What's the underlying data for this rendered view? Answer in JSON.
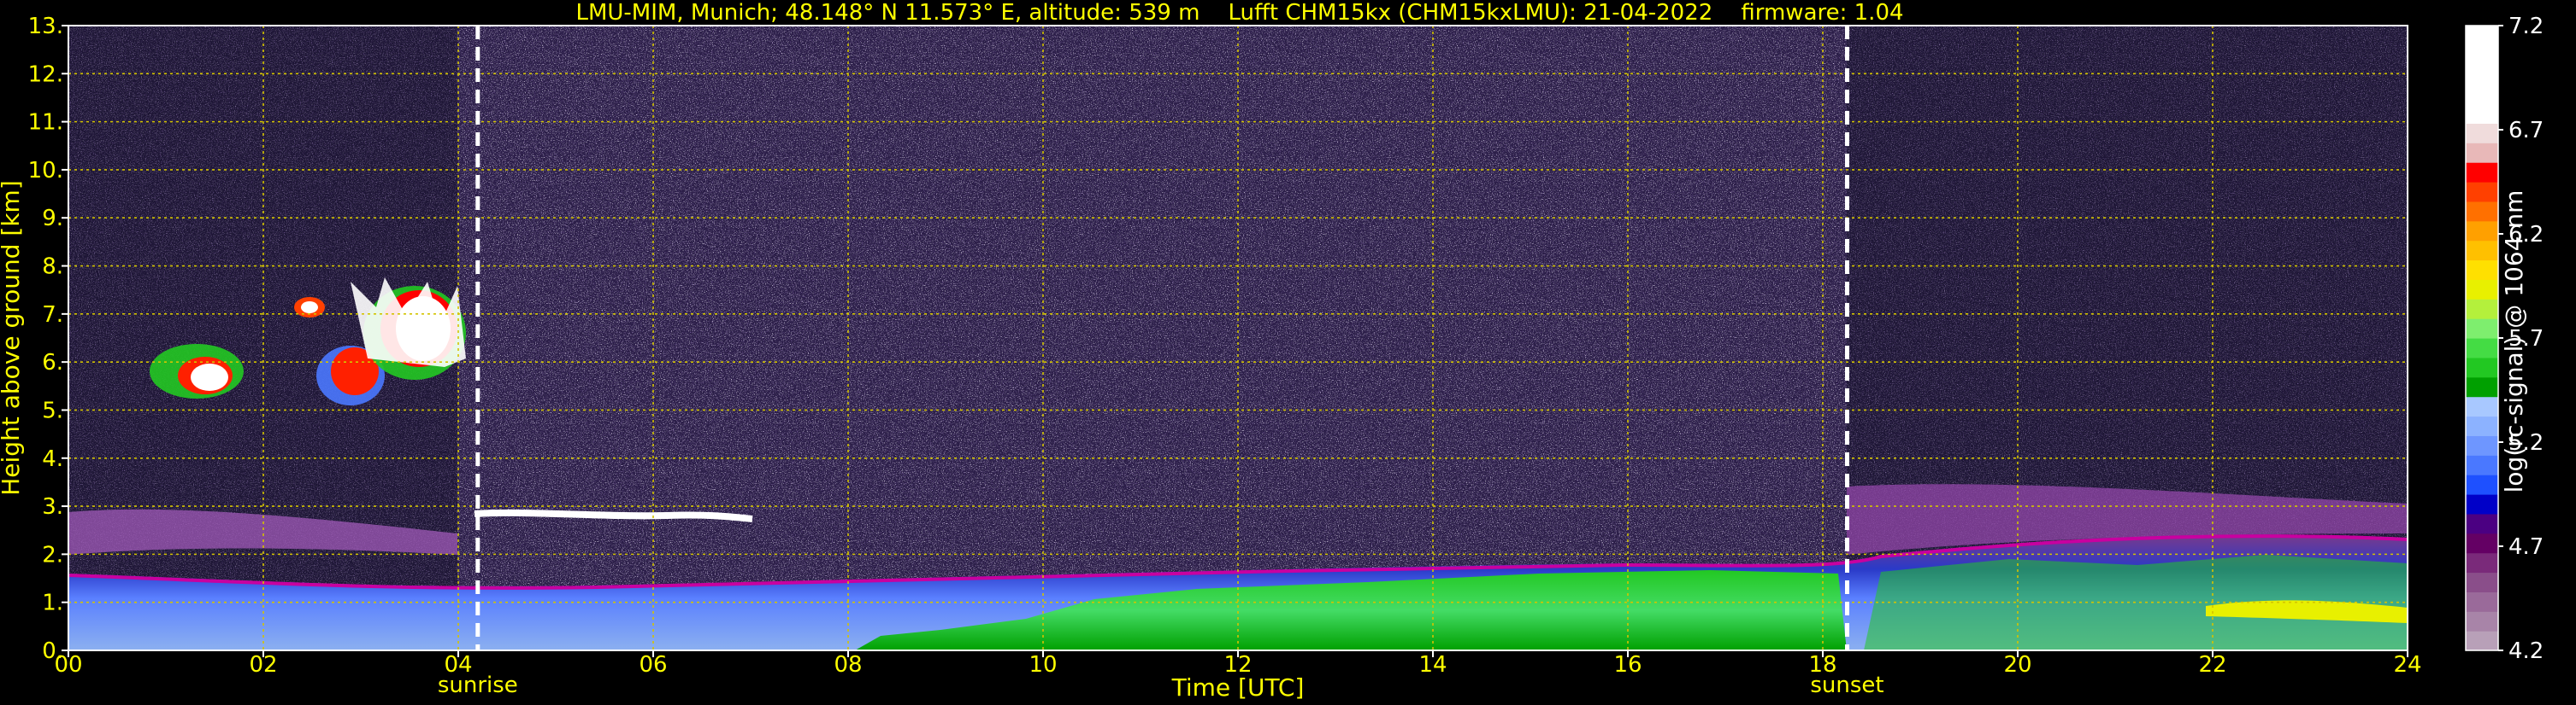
{
  "chart_data": {
    "type": "heatmap",
    "title": "LMU-MIM, Munich; 48.148° N 11.573° E, altitude: 539 m    Lufft CHM15kx (CHM15kxLMU): 21-04-2022    firmware: 1.04",
    "xlabel": "Time [UTC]",
    "ylabel": "Height above ground [km]",
    "xlim": [
      0,
      24
    ],
    "ylim": [
      0,
      13
    ],
    "x_ticks": [
      "00",
      "02",
      "04",
      "06",
      "08",
      "10",
      "12",
      "14",
      "16",
      "18",
      "20",
      "22",
      "24"
    ],
    "y_ticks": [
      "0.",
      "1.",
      "2.",
      "3.",
      "4.",
      "5.",
      "6.",
      "7.",
      "8.",
      "9.",
      "10.",
      "11.",
      "12.",
      "13."
    ],
    "grid": true,
    "colorbar": {
      "label": "log(rc-signal) @ 1064 nm",
      "range": [
        4.2,
        7.2
      ],
      "ticks": [
        "4.2",
        "4.7",
        "5.2",
        "5.7",
        "6.2",
        "6.7",
        "7.2"
      ],
      "colors": [
        "#b8a0b8",
        "#a884a8",
        "#9a6a9a",
        "#8a4e8a",
        "#7a2a7a",
        "#640064",
        "#4b0082",
        "#0000c8",
        "#1e50ff",
        "#4a78ff",
        "#6e96ff",
        "#8cb2ff",
        "#a8c8ff",
        "#00a000",
        "#22c822",
        "#44dc44",
        "#7eee6e",
        "#b4f03c",
        "#e8f000",
        "#ffe000",
        "#ffc000",
        "#ffa000",
        "#ff7000",
        "#ff4000",
        "#ff0000",
        "#e8b8b8",
        "#f0dcdc",
        "#ffffff",
        "#ffffff",
        "#ffffff",
        "#ffffff",
        "#ffffff"
      ]
    },
    "annotations": [
      {
        "text": "sunrise",
        "x": 4.2
      },
      {
        "text": "sunset",
        "x": 18.25
      }
    ]
  }
}
